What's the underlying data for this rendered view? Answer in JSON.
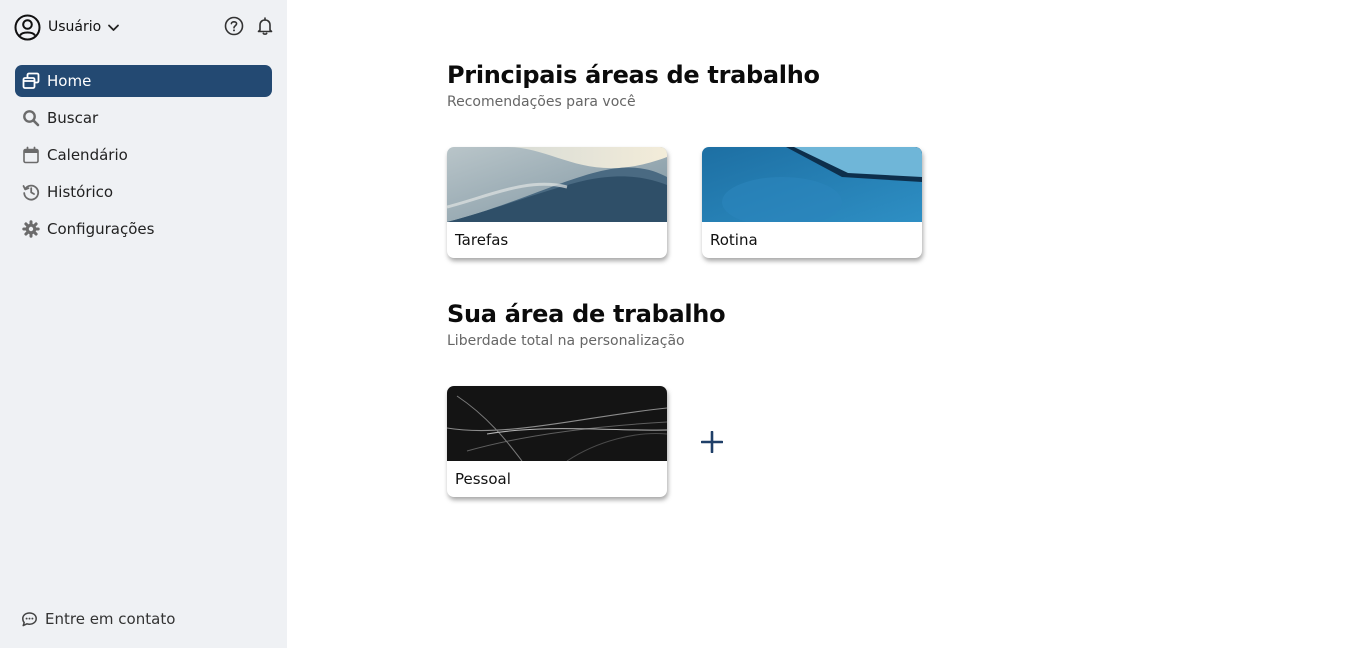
{
  "user": {
    "name": "Usuário"
  },
  "icons": {
    "avatar": "user-circle-icon",
    "dropdown": "chevron-down-icon",
    "help": "help-circle-icon",
    "notifications": "bell-icon",
    "contact": "chat-bubble-icon",
    "add": "plus-icon"
  },
  "sidebar": {
    "items": [
      {
        "label": "Home",
        "icon": "windows-icon",
        "active": true
      },
      {
        "label": "Buscar",
        "icon": "search-icon"
      },
      {
        "label": "Calendário",
        "icon": "calendar-icon"
      },
      {
        "label": "Histórico",
        "icon": "history-icon"
      },
      {
        "label": "Configurações",
        "icon": "gear-icon"
      }
    ],
    "contact_label": "Entre em contato"
  },
  "main": {
    "recommended": {
      "title": "Principais áreas de trabalho",
      "subtitle": "Recomendações para você",
      "cards": [
        {
          "label": "Tarefas"
        },
        {
          "label": "Rotina"
        }
      ]
    },
    "yours": {
      "title": "Sua área de trabalho",
      "subtitle": "Liberdade total na personalização",
      "cards": [
        {
          "label": "Pessoal"
        }
      ]
    }
  },
  "colors": {
    "sidebar_bg": "#eff1f4",
    "accent": "#234972",
    "add_icon": "#1f3f68"
  }
}
